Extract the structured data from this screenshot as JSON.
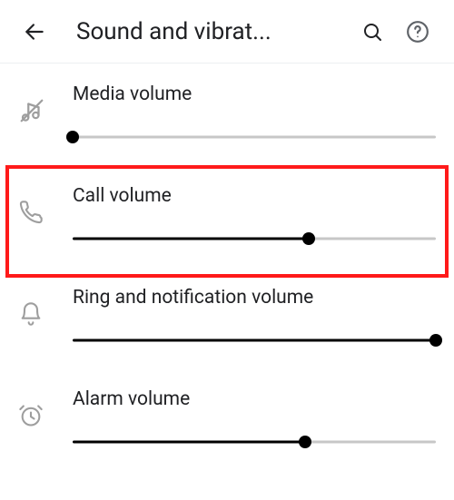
{
  "header": {
    "title": "Sound and vibrat...",
    "back_icon": "arrow-left",
    "search_icon": "search",
    "help_icon": "help-circle"
  },
  "volumes": [
    {
      "id": "media",
      "label": "Media volume",
      "icon": "media-muted",
      "value": 0,
      "highlighted": false
    },
    {
      "id": "call",
      "label": "Call volume",
      "icon": "phone",
      "value": 65,
      "highlighted": true
    },
    {
      "id": "ring",
      "label": "Ring and notification volume",
      "icon": "bell",
      "value": 100,
      "highlighted": false
    },
    {
      "id": "alarm",
      "label": "Alarm volume",
      "icon": "alarm-clock",
      "value": 64,
      "highlighted": false
    }
  ]
}
